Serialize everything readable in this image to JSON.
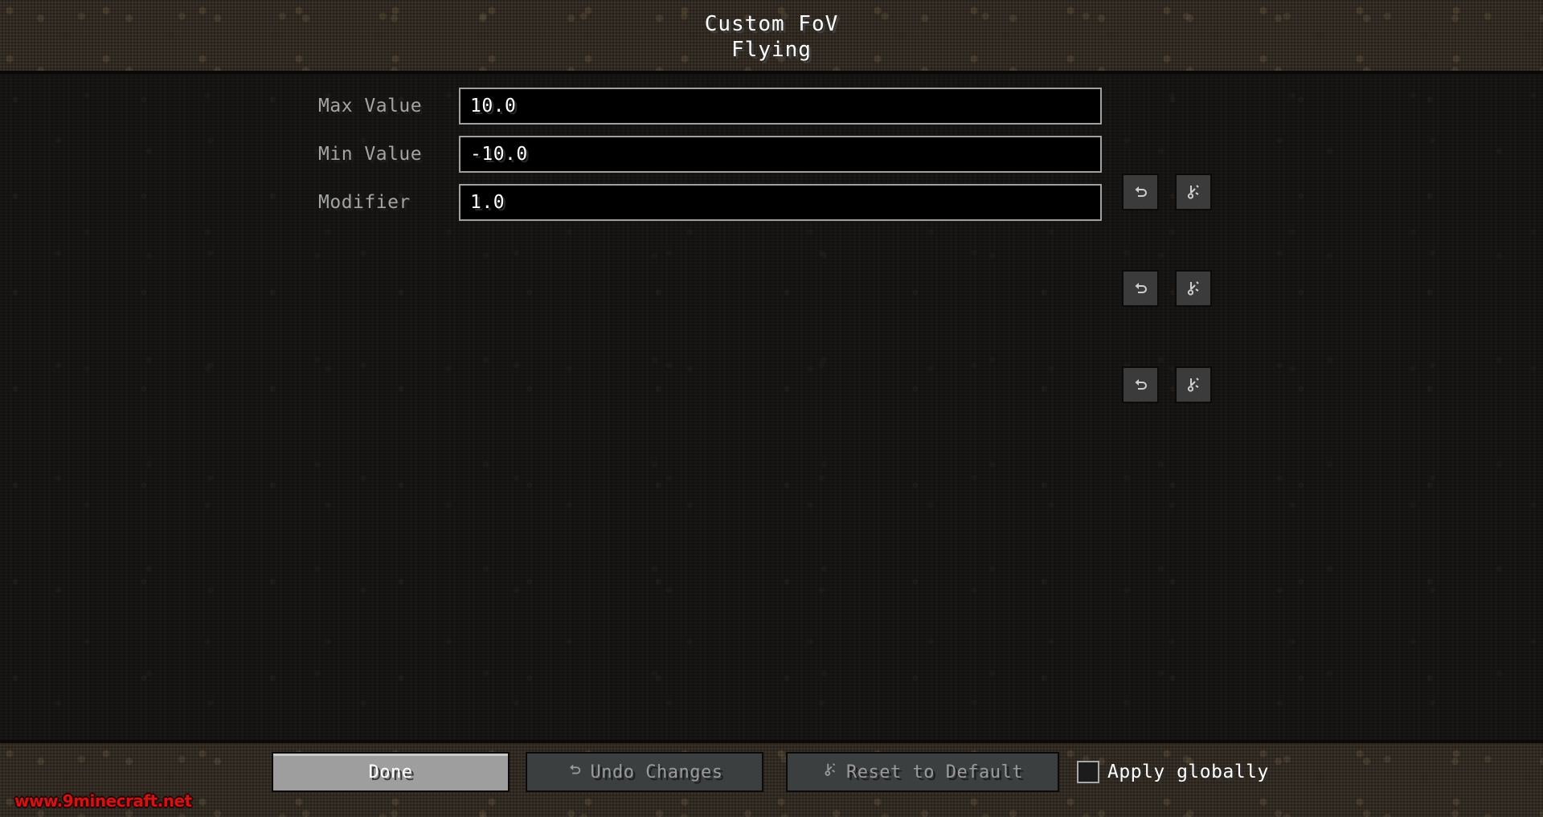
{
  "window": {
    "title": "Custom FoV",
    "subtitle": "Flying"
  },
  "form": {
    "rows": [
      {
        "label": "Max Value",
        "value": "10.0",
        "undo_icon": "undo-arrow-icon",
        "reset_icon": "broom-reset-icon"
      },
      {
        "label": "Min Value",
        "value": "-10.0",
        "undo_icon": "undo-arrow-icon",
        "reset_icon": "broom-reset-icon"
      },
      {
        "label": "Modifier",
        "value": "1.0",
        "undo_icon": "undo-arrow-icon",
        "reset_icon": "broom-reset-icon"
      }
    ]
  },
  "footer": {
    "done_label": "Done",
    "undo_label": "Undo Changes",
    "reset_label": "Reset to Default",
    "apply_globally_label": "Apply globally",
    "apply_globally_checked": false,
    "undo_icon": "undo-arrow-icon",
    "reset_icon": "broom-reset-icon"
  },
  "watermark": {
    "text": "www.9minecraft.net"
  },
  "colors": {
    "dirt_bar": "#2b241b",
    "body_bg": "#131110",
    "input_bg": "#000000",
    "input_border": "#a0a0a0",
    "label_text": "#a4a4a4",
    "value_text": "#ffffff",
    "button_dark": "#3b3f40",
    "button_light": "#9b9b9b",
    "disabled_text": "#9a9a9a",
    "watermark_red": "#d01414"
  }
}
